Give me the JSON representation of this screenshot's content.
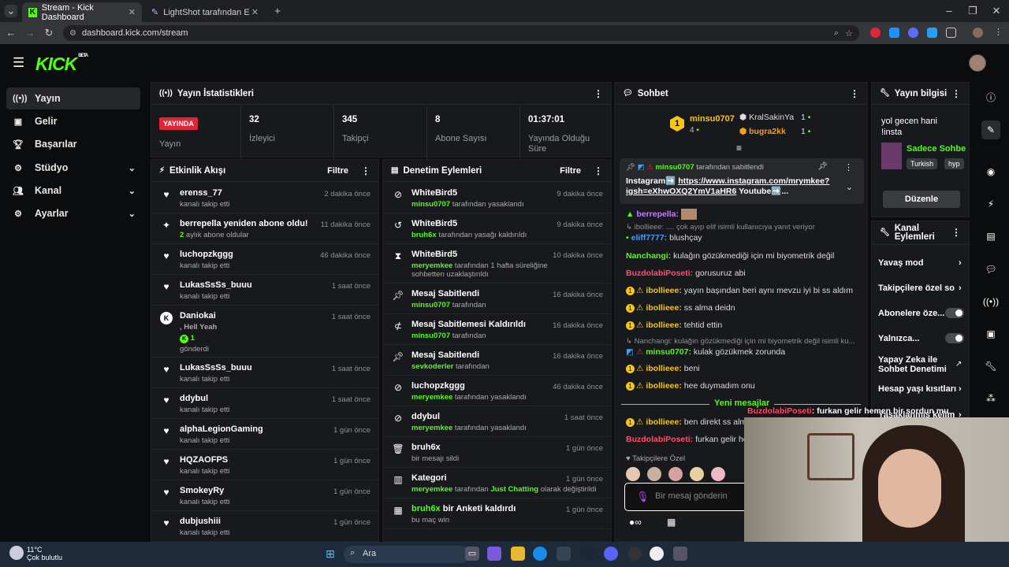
{
  "browser": {
    "tabs": [
      {
        "title": "Stream - Kick Dashboard"
      },
      {
        "title": "LightShot tarafından Ekran Gön"
      }
    ],
    "url": "dashboard.kick.com/stream"
  },
  "topbar": {
    "logo": "KICK",
    "logo_sup": "BETA"
  },
  "sidebar": {
    "items": [
      {
        "label": "Yayın",
        "icon": "broadcast-icon"
      },
      {
        "label": "Gelir",
        "icon": "wallet-icon"
      },
      {
        "label": "Başarılar",
        "icon": "trophy-icon"
      },
      {
        "label": "Stüdyo",
        "icon": "gear-icon"
      },
      {
        "label": "Kanal",
        "icon": "users-icon"
      },
      {
        "label": "Ayarlar",
        "icon": "settings-icon"
      }
    ]
  },
  "stats": {
    "title": "Yayın İstatistikleri",
    "live_badge": "YAYINDA",
    "live_label": "Yayın",
    "items": [
      {
        "value": "32",
        "label": "İzleyici"
      },
      {
        "value": "345",
        "label": "Takipçi"
      },
      {
        "value": "8",
        "label": "Abone Sayısı"
      },
      {
        "value": "01:37:01",
        "label": "Yayında Olduğu Süre"
      }
    ]
  },
  "activity": {
    "title": "Etkinlik Akışı",
    "filter": "Filtre",
    "items": [
      {
        "name": "erenss_77",
        "sub": "kanalı takip etti",
        "time": "2 dakika önce",
        "icon": "heart-icon"
      },
      {
        "name": "berrepella yeniden abone oldu!",
        "sub_count": "2",
        "sub": " aylık abone oldular",
        "time": "11 dakika önce",
        "icon": "sparkle-icon"
      },
      {
        "name": "luchopzkggg",
        "sub": "kanalı takip etti",
        "time": "46 dakika önce",
        "icon": "heart-icon"
      },
      {
        "name": "LukasSsSs_buuu",
        "sub": "kanalı takip etti",
        "time": "1 saat önce",
        "icon": "heart-icon"
      },
      {
        "name": "Daniokai",
        "msg": ", Hell Yeah",
        "count": "1",
        "sub": "gönderdi",
        "time": "1 saat önce",
        "icon": "kick-icon"
      },
      {
        "name": "LukasSsSs_buuu",
        "sub": "kanalı takip etti",
        "time": "1 saat önce",
        "icon": "heart-icon"
      },
      {
        "name": "ddybul",
        "sub": "kanalı takip etti",
        "time": "1 saat önce",
        "icon": "heart-icon"
      },
      {
        "name": "alphaLegionGaming",
        "sub": "kanalı takip etti",
        "time": "1 gün önce",
        "icon": "heart-icon"
      },
      {
        "name": "HQZAOFPS",
        "sub": "kanalı takip etti",
        "time": "1 gün önce",
        "icon": "heart-icon"
      },
      {
        "name": "SmokeyRy",
        "sub": "kanalı takip etti",
        "time": "1 gün önce",
        "icon": "heart-icon"
      },
      {
        "name": "dubjushiii",
        "sub": "kanalı takip etti",
        "time": "1 gün önce",
        "icon": "heart-icon"
      }
    ]
  },
  "moderation": {
    "title": "Denetim Eylemleri",
    "filter": "Filtre",
    "items": [
      {
        "name": "WhiteBird5",
        "actor": "minsu0707",
        "sub": " tarafından yasaklandı",
        "time": "9 dakika önce",
        "icon": "ban-icon"
      },
      {
        "name": "WhiteBird5",
        "actor": "bruh6x",
        "sub": " tarafından yasağı kaldırıldı",
        "time": "9 dakika önce",
        "icon": "undo-icon"
      },
      {
        "name": "WhiteBird5",
        "actor": "meryemkee",
        "sub": " tarafından 1 hafta süreliğine sohbetten uzaklaştırıldı",
        "time": "10 dakika önce",
        "icon": "hourglass-icon"
      },
      {
        "name": "Mesaj Sabitlendi",
        "actor": "minsu0707",
        "sub": " tarafından",
        "time": "16 dakika önce",
        "icon": "pin-icon"
      },
      {
        "name": "Mesaj Sabitlemesi Kaldırıldı",
        "actor": "minsu0707",
        "sub": " tarafından",
        "time": "16 dakika önce",
        "icon": "unpin-icon"
      },
      {
        "name": "Mesaj Sabitlendi",
        "actor": "sevkoderler",
        "sub": " tarafından",
        "time": "16 dakika önce",
        "icon": "pin-icon"
      },
      {
        "name": "luchopzkggg",
        "actor": "meryemkee",
        "sub": " tarafından yasaklandı",
        "time": "46 dakika önce",
        "icon": "ban-icon"
      },
      {
        "name": "ddybul",
        "actor": "meryemkee",
        "sub": " tarafından yasaklandı",
        "time": "1 saat önce",
        "icon": "ban-icon"
      },
      {
        "name": "bruh6x",
        "actor": "",
        "sub": "bir mesajı sildi",
        "time": "1 gün önce",
        "icon": "trash-icon"
      },
      {
        "name": "Kategori",
        "actor": "meryemkee",
        "sub": " tarafından ",
        "extra": "Just Chatting",
        "extra2": " olarak değiştirildi",
        "time": "1 gün önce",
        "icon": "category-icon"
      },
      {
        "name": "bruh6x",
        "name_rest": " bir Anketi kaldırdı",
        "actor": "",
        "sub": "bu maç win",
        "time": "1 gün önce",
        "icon": "poll-icon"
      }
    ]
  },
  "chat": {
    "title": "Sohbet",
    "leader1": {
      "rank": "1",
      "name": "minsu0707",
      "count": "4"
    },
    "leader2": {
      "name": "KralSakinYa",
      "count": "1"
    },
    "leader3": {
      "name": "bugra2kk",
      "count": "1"
    },
    "pinned": {
      "by": "minsu0707",
      "by_suffix": " tarafından sabitlendi",
      "text1": "Instagram➡️ ",
      "link": "https://www.instagram.com/mrymkee?igsh=eXhwOXQ2YmV1aHR6",
      "text2": " Youtube➡️..."
    },
    "messages": [
      {
        "user": "berrepella:",
        "color": "#c77dff",
        "text": ""
      },
      {
        "reply": "ibollieee: .... çok ayıp elif isimli kullanıcıya yanıt veriyor"
      },
      {
        "user": "eliff7777:",
        "color": "#4a9cff",
        "text": " blushçay"
      },
      {
        "user": "Nanchangi:",
        "color": "#53fc18",
        "text": " kulağın gözükmediği için mi biyometrik değil"
      },
      {
        "user": "BuzdolabiPoseti:",
        "color": "#ff4f6d",
        "text": " gorusuruz abi"
      },
      {
        "user": "ibollieee:",
        "color": "#f5c518",
        "text": " yayın başından beri aynı mevzu iyi bi ss aldım"
      },
      {
        "user": "ibollieee:",
        "color": "#f5c518",
        "text": " ss alma deidn"
      },
      {
        "user": "ibollieee:",
        "color": "#f5c518",
        "text": " tehtid ettin"
      },
      {
        "reply": "Nanchangi: kulağın gözükmediği için mi biyometrik değil isimli ku..."
      },
      {
        "user": "minsu0707:",
        "color": "#53fc18",
        "text": " kulak gözükmek zorunda"
      },
      {
        "user": "ibollieee:",
        "color": "#f5c518",
        "text": " beni"
      },
      {
        "user": "ibollieee:",
        "color": "#f5c518",
        "text": " hee duymadım onu"
      },
      {
        "divider": "Yeni mesajlar"
      },
      {
        "user": "ibollieee:",
        "color": "#f5c518",
        "text": " ben direkt ss alm"
      },
      {
        "user": "BuzdolabiPoseti:",
        "color": "#ff4f6d",
        "text": " furkan gelir hem"
      }
    ],
    "overlay_user": "BuzdolabiPoseti",
    "overlay_text": ": furkan gelir hemen bir sordun mu",
    "followers_only": "Takipçilere Özel",
    "input_placeholder": "Bir mesaj gönderin"
  },
  "info": {
    "title": "Yayın bilgisi",
    "stream_title": "yol gecen hani !insta",
    "category": "Sadece Sohbe",
    "tags": [
      "Turkish",
      "hyp"
    ],
    "edit": "Düzenle"
  },
  "channel_actions": {
    "title": "Kanal Eylemleri",
    "items": [
      {
        "label": "Yavaş mod",
        "control": "chevron"
      },
      {
        "label": "Takipçilere özel so",
        "control": "chevron"
      },
      {
        "label": "Abonelere öze...",
        "control": "toggle"
      },
      {
        "label": "Yalnızca...",
        "control": "toggle"
      },
      {
        "label": "Yapay Zeka ile Sohbet Denetimi",
        "control": "external"
      },
      {
        "label": "Hesap yaşı kısıtları",
        "control": "chevron"
      },
      {
        "label": "Yasaklanmış kelim",
        "control": "chevron"
      }
    ]
  },
  "taskbar": {
    "weather_temp": "11°C",
    "weather_desc": "Çok bulutlu",
    "search": "Ara"
  }
}
